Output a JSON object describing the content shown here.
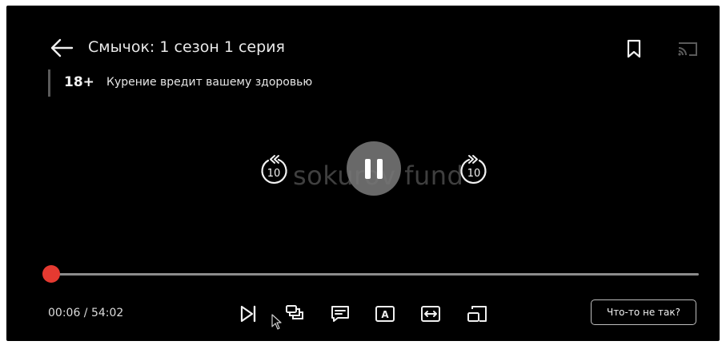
{
  "header": {
    "title": "Смычок: 1 сезон 1 серия",
    "back_icon": "arrow-left-icon",
    "bookmark_icon": "bookmark-icon",
    "cast_icon": "cast-icon"
  },
  "notice": {
    "age_rating": "18+",
    "warning": "Курение вредит вашему здоровью"
  },
  "center": {
    "watermark": "sokurov fund",
    "rewind_seconds": "10",
    "forward_seconds": "10",
    "state": "playing"
  },
  "progress": {
    "current": "00:06",
    "total": "54:02",
    "time_text": "00:06 / 54:02",
    "fraction": 0.002
  },
  "controls": {
    "icons": [
      "next-episode-icon",
      "episodes-icon",
      "subtitles-icon",
      "audio-track-icon",
      "aspect-ratio-icon",
      "picture-in-picture-icon"
    ],
    "audio_label": "A",
    "report_label": "Что-то не так?"
  },
  "colors": {
    "accent": "#e53a31",
    "background": "#000000",
    "track": "#8c8c8c"
  }
}
